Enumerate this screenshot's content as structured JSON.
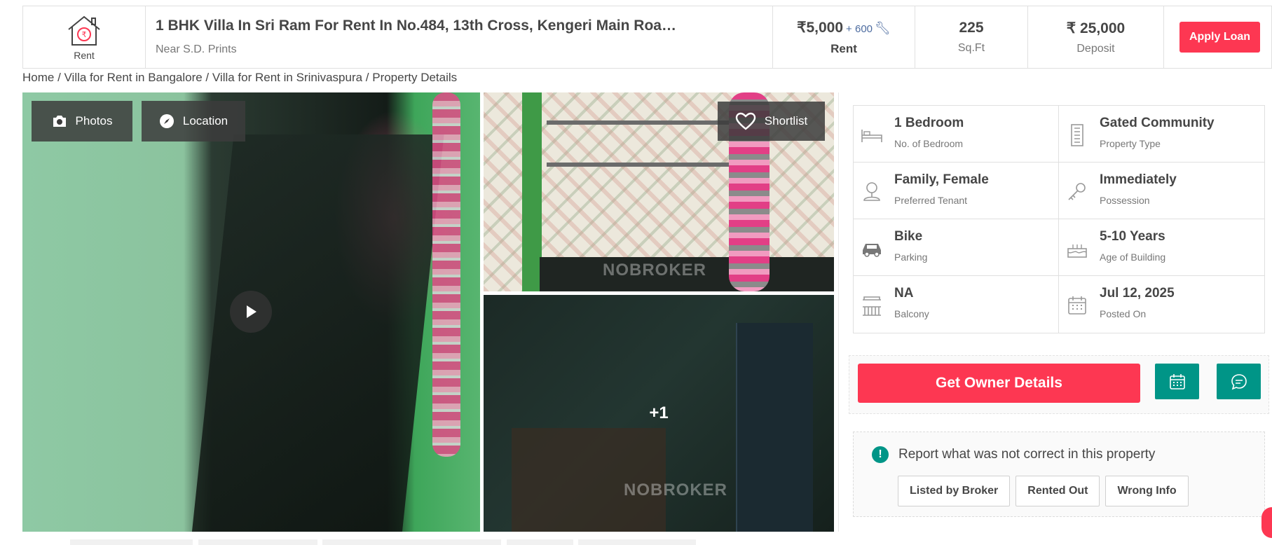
{
  "header": {
    "type_label": "Rent",
    "title": "1 BHK Villa In Sri Ram For Rent In No.484, 13th Cross, Kengeri Main Roa…",
    "subtitle": "Near S.D. Prints",
    "rent_value": "₹5,000",
    "rent_extra": "+ 600",
    "rent_label": "Rent",
    "area_value": "225",
    "area_label": "Sq.Ft",
    "deposit_value": "₹ 25,000",
    "deposit_label": "Deposit",
    "apply_loan": "Apply Loan"
  },
  "breadcrumb": "Home / Villa for Rent in Bangalore / Villa for Rent in Srinivaspura / Property Details",
  "gallery": {
    "photos_label": "Photos",
    "location_label": "Location",
    "shortlist_label": "Shortlist",
    "more_count": "+1",
    "watermark": "NOBROKER"
  },
  "details": [
    {
      "value": "1 Bedroom",
      "label": "No. of Bedroom",
      "icon": "bed-icon"
    },
    {
      "value": "Gated Community",
      "label": "Property Type",
      "icon": "building-icon"
    },
    {
      "value": "Family, Female",
      "label": "Preferred Tenant",
      "icon": "tenant-icon"
    },
    {
      "value": "Immediately",
      "label": "Possession",
      "icon": "key-icon"
    },
    {
      "value": "Bike",
      "label": "Parking",
      "icon": "car-icon"
    },
    {
      "value": "5-10 Years",
      "label": "Age of Building",
      "icon": "cake-icon"
    },
    {
      "value": "NA",
      "label": "Balcony",
      "icon": "balcony-icon"
    },
    {
      "value": "Jul 12, 2025",
      "label": "Posted On",
      "icon": "calendar-icon"
    }
  ],
  "actions": {
    "get_owner": "Get Owner Details"
  },
  "report": {
    "heading": "Report what was not correct in this property",
    "options": [
      "Listed by Broker",
      "Rented Out",
      "Wrong Info"
    ]
  },
  "colors": {
    "brand_red": "#fd3752",
    "teal": "#009587",
    "text": "#464646"
  }
}
